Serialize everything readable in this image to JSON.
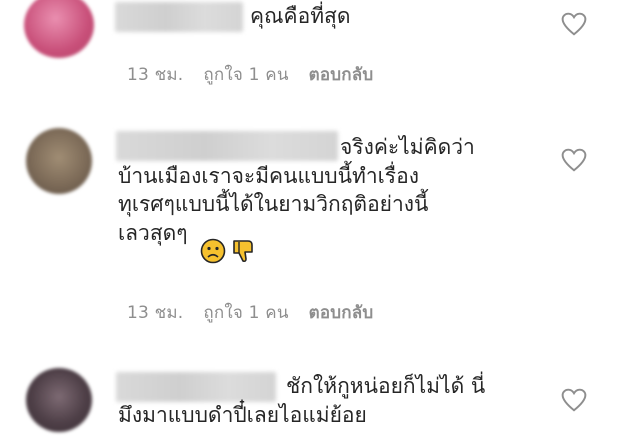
{
  "comments": [
    {
      "text": "คุณคือที่สุด",
      "time": "13 ชม.",
      "likes": "ถูกใจ 1 คน",
      "reply": "ตอบกลับ",
      "avatar_color": "#d9668e"
    },
    {
      "text": "จริงค่ะไม่คิดว่า\nบ้านเมืองเราจะมีคนแบบนี้ทำเรื่อง\nทุเรศๆแบบนี้ได้ในยามวิกฤติอย่างนี้\nเลวสุดๆ",
      "time": "13 ชม.",
      "likes": "ถูกใจ 1 คน",
      "reply": "ตอบกลับ",
      "emojis": [
        "frowning-face-emoji",
        "thumbs-down-emoji"
      ],
      "avatar_color": "#8a7a66"
    },
    {
      "text": "ชักให้กูหน่อยก็ไม่ได้ นี่\nมึงมาแบบดำปี๋เลยไอแม่ย้อย",
      "avatar_color": "#5a4a52"
    }
  ],
  "icons": {
    "like": "heart-outline-icon"
  }
}
